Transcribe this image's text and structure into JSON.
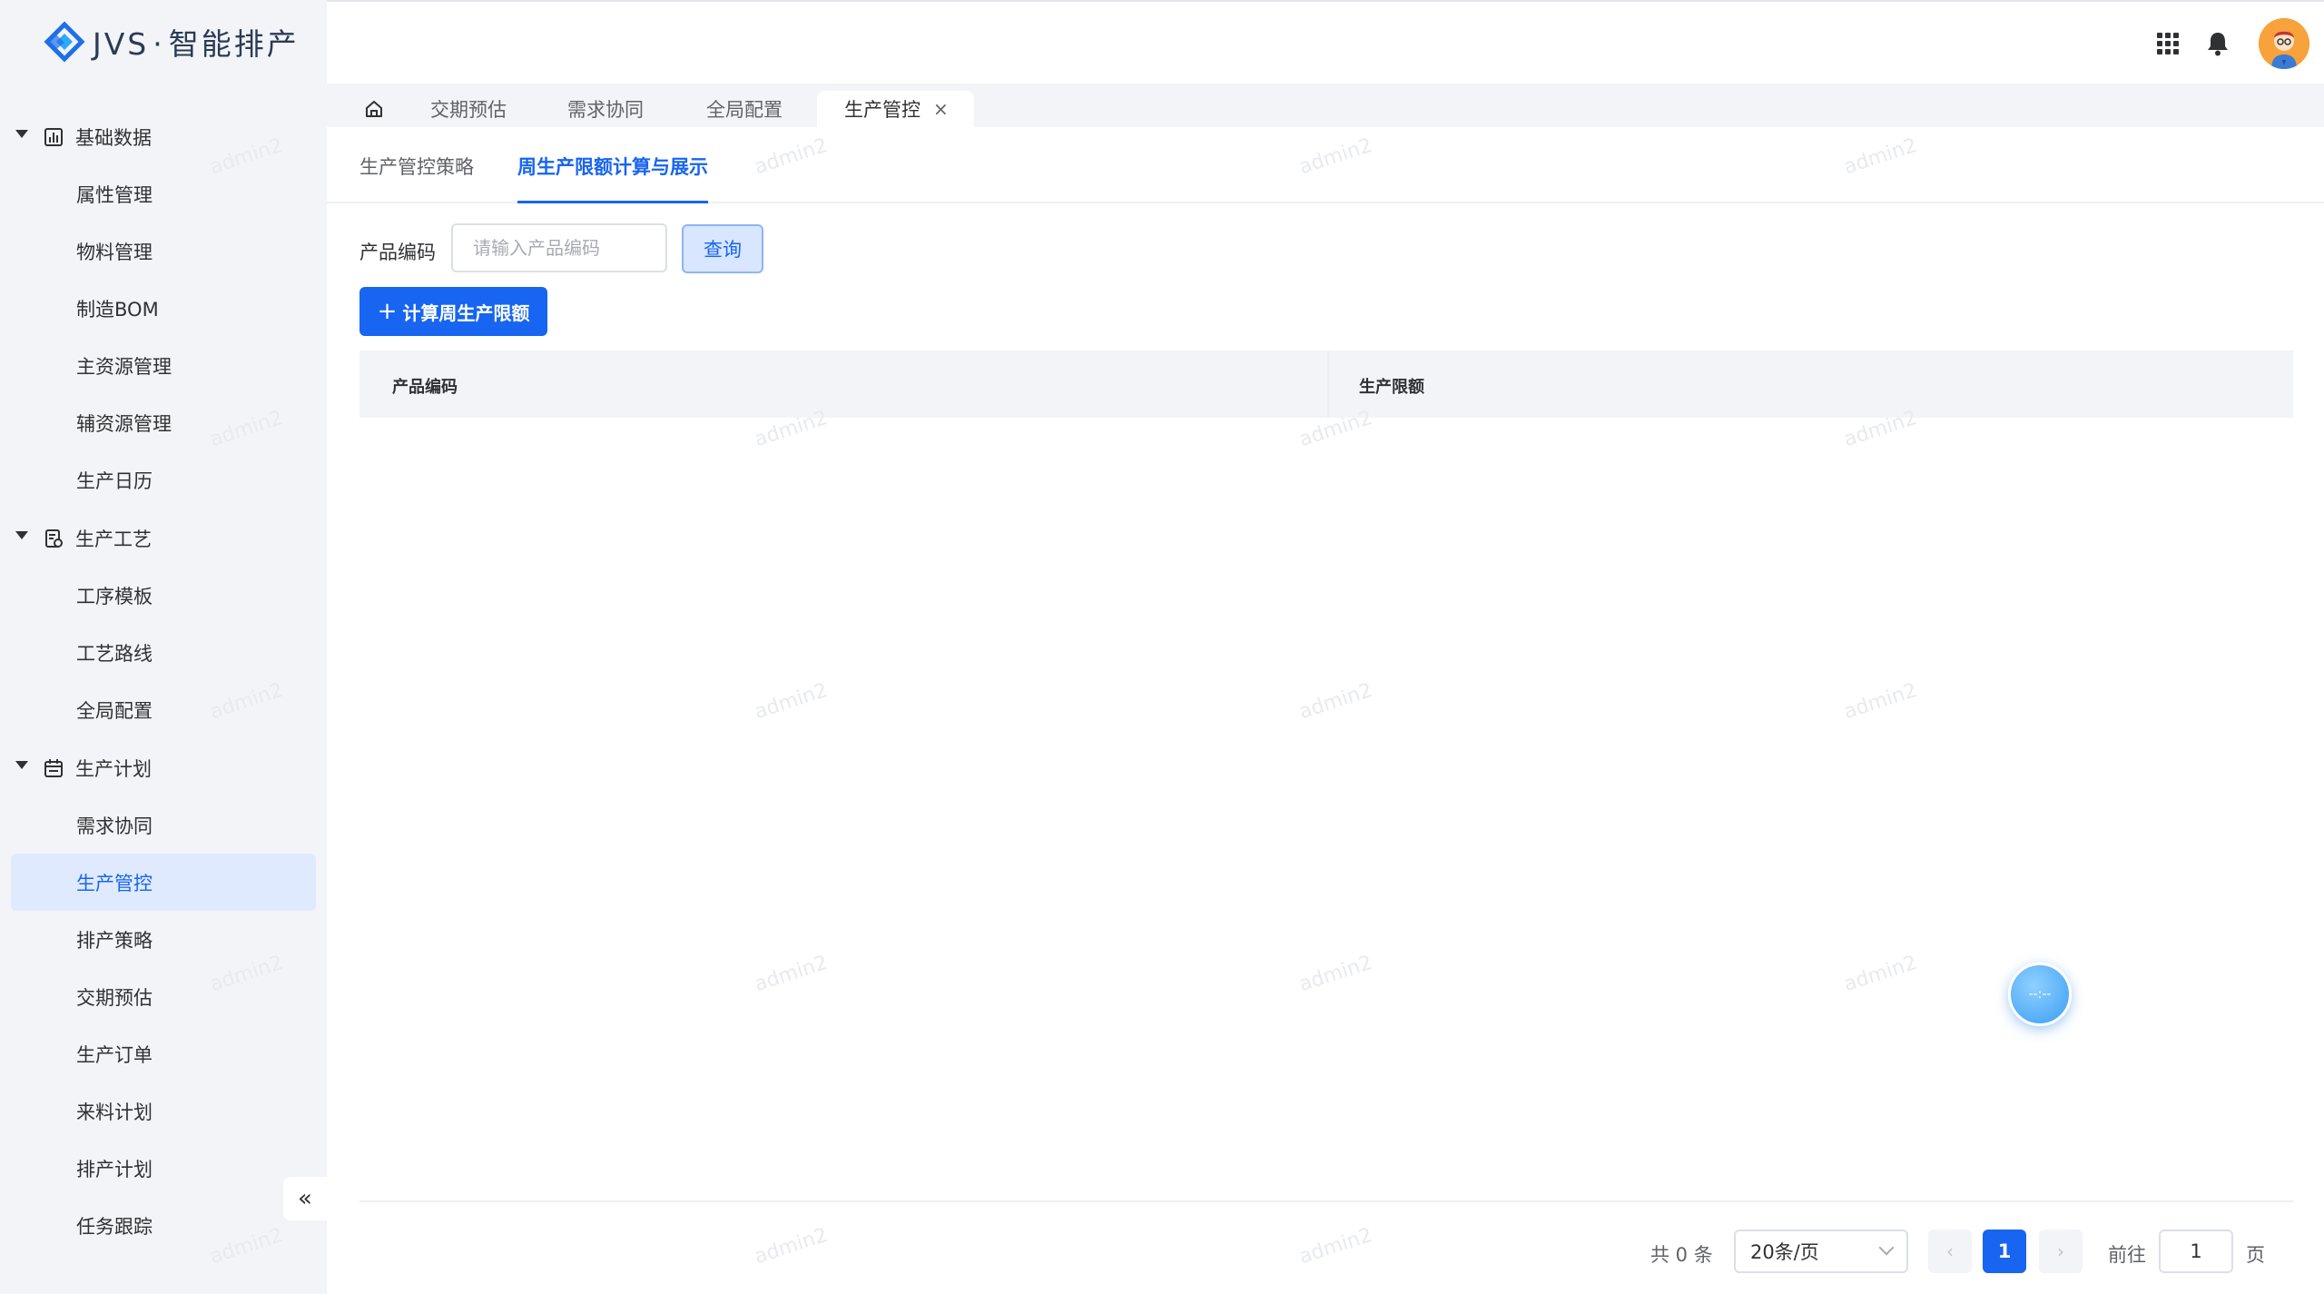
{
  "logo": {
    "brand": "JVS",
    "separator": "·",
    "product": "智能排产"
  },
  "sidebar": {
    "groups": [
      {
        "label": "基础数据",
        "items": [
          "属性管理",
          "物料管理",
          "制造BOM",
          "主资源管理",
          "辅资源管理",
          "生产日历"
        ]
      },
      {
        "label": "生产工艺",
        "items": [
          "工序模板",
          "工艺路线",
          "全局配置"
        ]
      },
      {
        "label": "生产计划",
        "items": [
          "需求协同",
          "生产管控",
          "排产策略",
          "交期预估",
          "生产订单",
          "来料计划",
          "排产计划",
          "任务跟踪"
        ]
      }
    ],
    "active_item": "生产管控",
    "collapse_label": "«"
  },
  "tabs": {
    "items": [
      "交期预估",
      "需求协同",
      "全局配置",
      "生产管控"
    ],
    "active": "生产管控",
    "close_glyph": "×"
  },
  "subtabs": {
    "items": [
      "生产管控策略",
      "周生产限额计算与展示"
    ],
    "active": "周生产限额计算与展示"
  },
  "filter": {
    "label": "产品编码",
    "placeholder": "请输入产品编码",
    "value": "",
    "query_button": "查询"
  },
  "actions": {
    "calc_button": "计算周生产限额",
    "calc_plus": "+"
  },
  "table": {
    "columns": [
      "产品编码",
      "生产限额"
    ],
    "rows": []
  },
  "pagination": {
    "total_text": "共 0 条",
    "page_size": "20条/页",
    "current_page": "1",
    "goto_prefix": "前往",
    "goto_value": "1",
    "goto_suffix": "页",
    "prev_glyph": "‹",
    "next_glyph": "›"
  },
  "float_ball": {
    "text": "--:--"
  },
  "watermark": "admin2",
  "colors": {
    "primary": "#1765f0",
    "sidebar_bg": "#f2f4f7",
    "active_bg": "#e0eaff"
  }
}
